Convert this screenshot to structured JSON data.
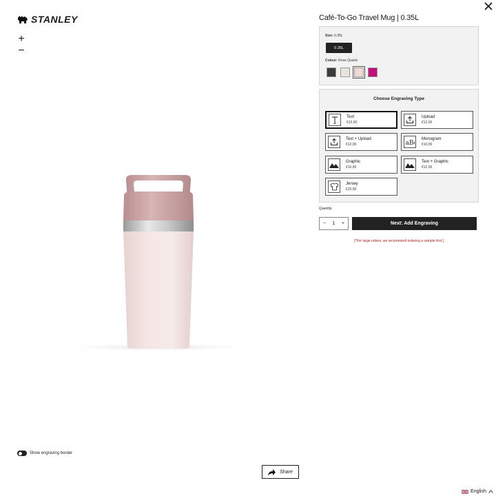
{
  "brand": {
    "name": "STANLEY"
  },
  "product": {
    "title": "Café-To-Go Travel Mug | 0.35L"
  },
  "size": {
    "label": "Size:",
    "value": "0.35L",
    "options": [
      "0.35L"
    ]
  },
  "colour": {
    "label": "Colour:",
    "value": "Rose Quartz",
    "swatches": [
      {
        "color": "#3a3b3c"
      },
      {
        "color": "#e8e4dc"
      },
      {
        "color": "#efd9d6",
        "selected": true
      },
      {
        "color": "#c4117a"
      }
    ]
  },
  "engraving": {
    "title": "Choose Engraving Type",
    "types": [
      {
        "name": "Text",
        "price": "€10,00",
        "icon": "text-icon",
        "selected": true
      },
      {
        "name": "Upload",
        "price": "€12,00",
        "icon": "upload-icon"
      },
      {
        "name": "Text + Upload",
        "price": "€12,00",
        "icon": "upload-icon"
      },
      {
        "name": "Monogram",
        "price": "€10,00",
        "icon": "monogram-icon"
      },
      {
        "name": "Graphic",
        "price": "€10,00",
        "icon": "mountain-icon"
      },
      {
        "name": "Text + Graphic",
        "price": "€12,00",
        "icon": "mountain-icon"
      },
      {
        "name": "Jersey",
        "price": "€10,00",
        "icon": "jersey-icon"
      }
    ]
  },
  "quantity": {
    "label": "Quantity",
    "value": "1",
    "minus": "−",
    "plus": "+"
  },
  "next_button": "Next: Add Engraving",
  "notice": "[*For large orders, we recommend ordering a sample first.]",
  "zoom": {
    "in": "+",
    "out": "−"
  },
  "toggle": {
    "label": "Show engraving border"
  },
  "share": {
    "label": "Share"
  },
  "language": {
    "label": "English"
  }
}
